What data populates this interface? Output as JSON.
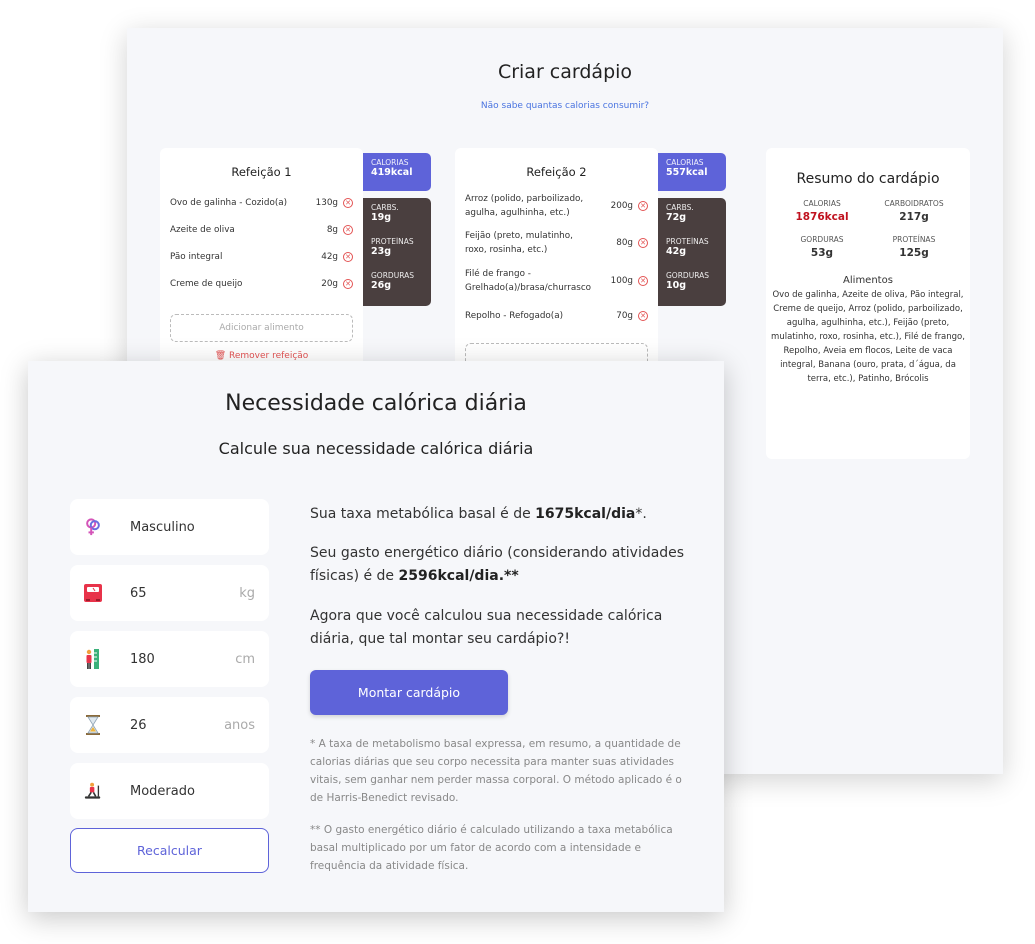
{
  "planner": {
    "title": "Criar cardápio",
    "calorie_link": "Não sabe quantas calorias consumir?",
    "meals": [
      {
        "title": "Refeição 1",
        "items": [
          {
            "name": "Ovo de galinha - Cozido(a)",
            "qty": "130g"
          },
          {
            "name": "Azeite de oliva",
            "qty": "8g"
          },
          {
            "name": "Pão integral",
            "qty": "42g"
          },
          {
            "name": "Creme de queijo",
            "qty": "20g"
          }
        ],
        "add_label": "Adicionar alimento",
        "remove_label": "Remover refeição",
        "calories_label": "CALORIAS",
        "calories": "419kcal",
        "carbs_label": "CARBS.",
        "carbs": "19g",
        "protein_label": "PROTEÍNAS",
        "protein": "23g",
        "fat_label": "GORDURAS",
        "fat": "26g"
      },
      {
        "title": "Refeição 2",
        "items": [
          {
            "name": "Arroz (polido, parboilizado, agulha, agulhinha, etc.)",
            "qty": "200g"
          },
          {
            "name": "Feijão (preto, mulatinho, roxo, rosinha, etc.)",
            "qty": "80g"
          },
          {
            "name": "Filé de frango - Grelhado(a)/brasa/churrasco",
            "qty": "100g"
          },
          {
            "name": "Repolho - Refogado(a)",
            "qty": "70g"
          }
        ],
        "calories_label": "CALORIAS",
        "calories": "557kcal",
        "carbs_label": "CARBS.",
        "carbs": "72g",
        "protein_label": "PROTEÍNAS",
        "protein": "42g",
        "fat_label": "GORDURAS",
        "fat": "10g"
      }
    ],
    "summary": {
      "title": "Resumo do cardápio",
      "calories_label": "CALORIAS",
      "calories": "1876kcal",
      "carbs_label": "CARBOIDRATOS",
      "carbs": "217g",
      "fat_label": "GORDURAS",
      "fat": "53g",
      "protein_label": "PROTEÍNAS",
      "protein": "125g",
      "foods_title": "Alimentos",
      "foods": "Ovo de galinha, Azeite de oliva, Pão integral, Creme de queijo, Arroz (polido, parboilizado, agulha, agulhinha, etc.), Feijão (preto, mulatinho, roxo, rosinha, etc.), Filé de frango, Repolho, Aveia em flocos, Leite de vaca integral, Banana (ouro, prata, d´água, da terra, etc.), Patinho, Brócolis"
    }
  },
  "calculator": {
    "title": "Necessidade calórica diária",
    "subtitle": "Calcule sua necessidade calórica diária",
    "fields": {
      "sex": "Masculino",
      "weight": "65",
      "weight_unit": "kg",
      "height": "180",
      "height_unit": "cm",
      "age": "26",
      "age_unit": "anos",
      "activity": "Moderado"
    },
    "recalc_label": "Recalcular",
    "result": {
      "bmr_prefix": "Sua taxa metabólica basal é de ",
      "bmr_value": "1675kcal/dia",
      "bmr_suffix": "*.",
      "tee_prefix": "Seu gasto energético diário (considerando atividades físicas) é de ",
      "tee_value": "2596kcal/dia.**",
      "cta_text": "Agora que você calculou sua necessidade calórica diária, que tal montar seu cardápio?!"
    },
    "mount_label": "Montar cardápio",
    "note1": "* A taxa de metabolismo basal expressa, em resumo, a quantidade de calorias diárias que seu corpo necessita para manter suas atividades vitais, sem ganhar nem perder massa corporal. O método aplicado é o de Harris-Benedict revisado.",
    "note2": "** O gasto energético diário é calculado utilizando a taxa metabólica basal multiplicado por um fator de acordo com a intensidade e frequência da atividade física."
  },
  "colors": {
    "accent": "#5e63d9",
    "macros_bg": "#4a3f3f",
    "danger": "#e35454",
    "calorie_red": "#c0121f"
  }
}
